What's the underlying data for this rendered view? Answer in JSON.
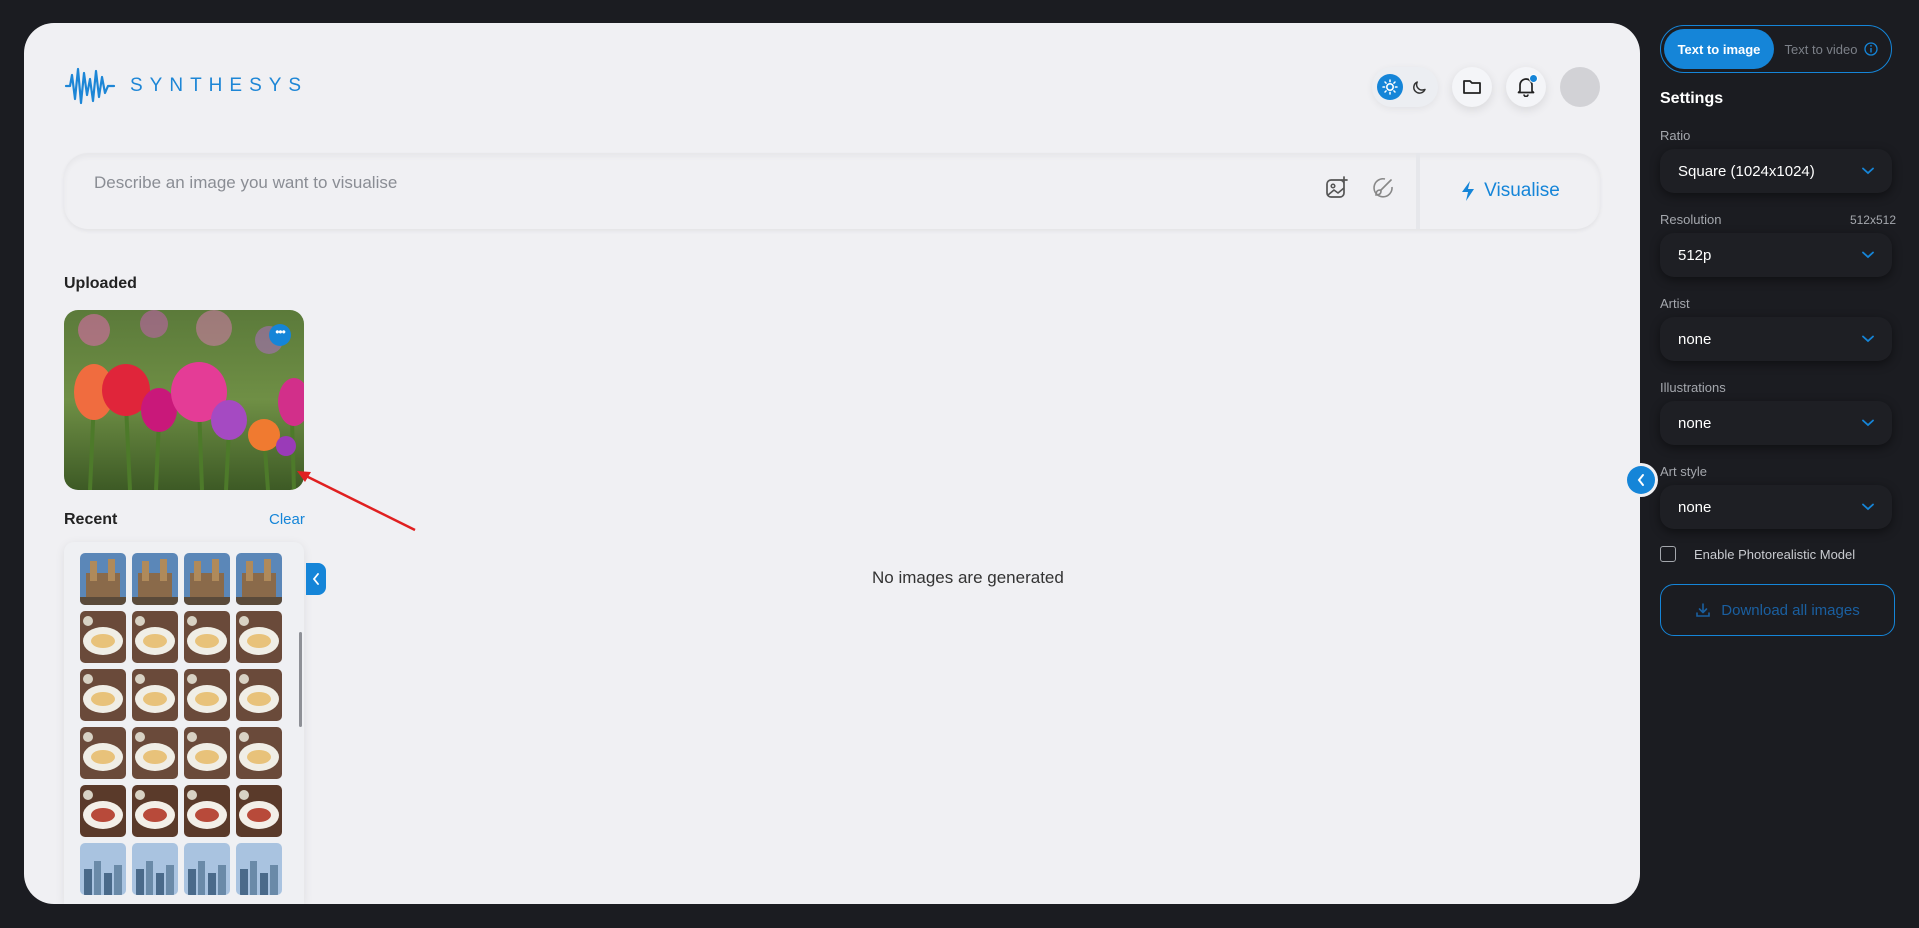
{
  "brand": {
    "name": "SYNTHESYS"
  },
  "header": {
    "theme_toggle": {
      "light_icon": "sun-icon",
      "dark_icon": "moon-icon",
      "active": "light"
    },
    "folder_icon": "folder-icon",
    "notification_icon": "bell-icon",
    "avatar": "avatar"
  },
  "prompt": {
    "placeholder": "Describe an image you want to visualise",
    "value": "",
    "icons": [
      "image-add-icon",
      "brush-icon"
    ],
    "visualise_label": "Visualise"
  },
  "uploaded": {
    "title": "Uploaded",
    "image": "tulip-field-photo"
  },
  "recent": {
    "title": "Recent",
    "clear_label": "Clear",
    "thumbnails": [
      "castle",
      "castle",
      "castle",
      "castle",
      "crepe-plate",
      "crepe-plate",
      "crepe-plate",
      "crepe-plate",
      "crepe-plate",
      "crepe-plate",
      "crepe-plate",
      "crepe-plate",
      "crepe-plate",
      "crepe-plate",
      "crepe-plate",
      "crepe-plate",
      "dessert-plate",
      "dessert-plate",
      "dessert-plate",
      "dessert-plate",
      "city-skyline",
      "city-skyline",
      "city-skyline",
      "city-skyline"
    ]
  },
  "main": {
    "empty_message": "No images are generated"
  },
  "sidebar": {
    "modes": [
      {
        "label": "Text to image",
        "active": true
      },
      {
        "label": "Text to video",
        "active": false
      }
    ],
    "settings_title": "Settings",
    "fields": [
      {
        "label": "Ratio",
        "value": "Square (1024x1024)",
        "extra": ""
      },
      {
        "label": "Resolution",
        "value": "512p",
        "extra": "512x512"
      },
      {
        "label": "Artist",
        "value": "none",
        "extra": ""
      },
      {
        "label": "Illustrations",
        "value": "none",
        "extra": ""
      },
      {
        "label": "Art style",
        "value": "none",
        "extra": ""
      }
    ],
    "photorealistic_label": "Enable Photorealistic Model",
    "photorealistic_checked": false,
    "download_label": "Download all images"
  },
  "colors": {
    "accent": "#1585d8",
    "background": "#1b1c21",
    "panel": "#f0f0f3",
    "annotation": "#e02020"
  }
}
